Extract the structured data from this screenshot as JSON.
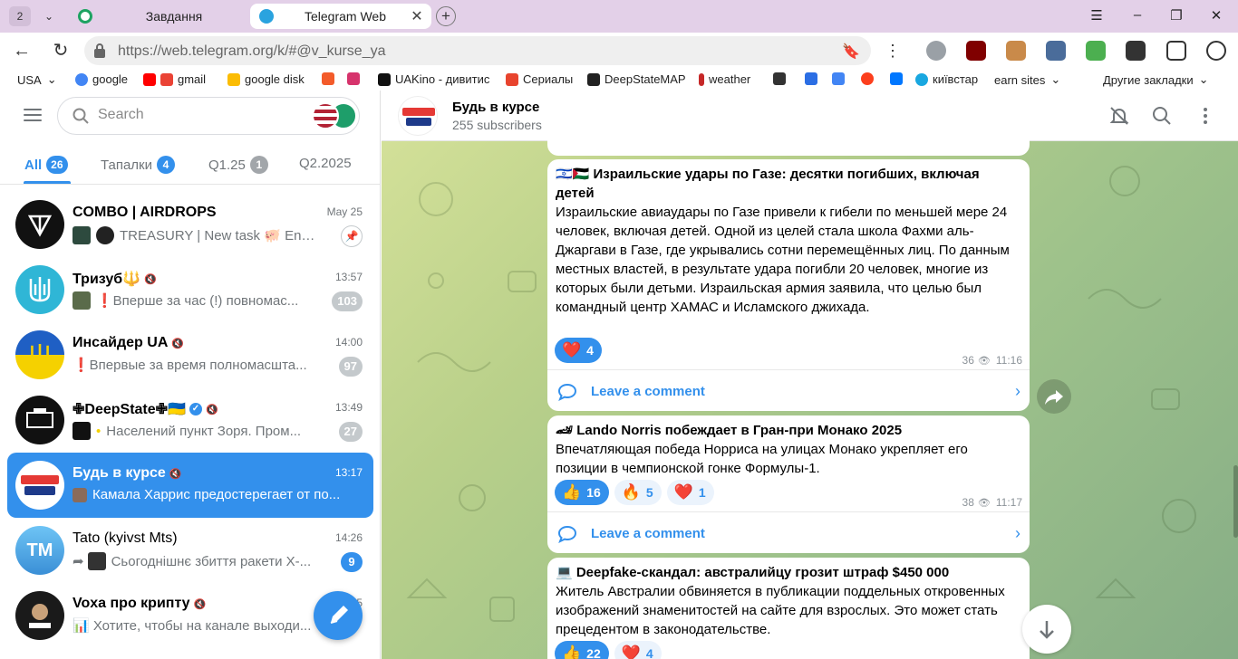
{
  "browser": {
    "tab_count": "2",
    "tabs": [
      {
        "title": "Завдання"
      },
      {
        "title": "Telegram Web"
      }
    ],
    "url": "https://web.telegram.org/k/#@v_kurse_ya",
    "bookmarks": [
      {
        "label": "USA"
      },
      {
        "label": "google"
      },
      {
        "label": "gmail"
      },
      {
        "label": "google disk"
      },
      {
        "label": "UAKino - дивитис"
      },
      {
        "label": "Сериалы"
      },
      {
        "label": "DeepStateMAP"
      },
      {
        "label": "weather"
      },
      {
        "label": "київстар"
      },
      {
        "label": "earn sites"
      },
      {
        "label": "Другие закладки"
      }
    ]
  },
  "sidebar": {
    "search_placeholder": "Search",
    "folders": [
      {
        "label": "All",
        "badge": "26"
      },
      {
        "label": "Тапалки",
        "badge": "4"
      },
      {
        "label": "Q1.25",
        "badge": "1"
      },
      {
        "label": "Q2.2025",
        "badge": ""
      }
    ],
    "chats": [
      {
        "name": "COMBO | AIRDROPS",
        "time": "May 25",
        "preview": "TREASURY | New task 🐖 Enter t...",
        "unread": ""
      },
      {
        "name": "Тризуб🔱",
        "time": "13:57",
        "preview": "❗️Вперше за час (!) повномас...",
        "unread": "103"
      },
      {
        "name": "Инсайдер UA",
        "time": "14:00",
        "preview": "❗️Впервые за время полномасшта...",
        "unread": "97"
      },
      {
        "name": "✙DeepState✙🇺🇦",
        "time": "13:49",
        "preview": "Населений пункт Зоря. Пром...",
        "unread": "27"
      },
      {
        "name": "Будь в курсе",
        "time": "13:17",
        "preview": "Камала Харрис предостерегает от по...",
        "unread": ""
      },
      {
        "name": "Tato (kyivst Mts)",
        "time": "14:26",
        "preview": "Сьогоднішнє збиття ракети Х-...",
        "unread": "9",
        "initials": "TM"
      },
      {
        "name": "Voxa про крипту",
        "time": "5",
        "preview": "📊 Хотите, чтобы на канале выходи...",
        "unread": ""
      }
    ]
  },
  "chat": {
    "title": "Будь в курсе",
    "subtitle": "255 subscribers",
    "messages": [
      {
        "headline": "🇮🇱🇵🇸 Израильские удары по Газе: десятки погибших, включая детей",
        "text": "Израильские авиаудары по Газе привели к гибели по меньшей мере 24 человек, включая детей. Одной из целей стала школа Фахми аль-Джаргави в Газе, где укрывались сотни перемещённых лиц. По данным местных властей, в результате удара погибли 20 человек, многие из которых были детьми. Израильская армия заявила, что целью был командный центр ХАМАС и Исламского джихада.",
        "reactions": [
          {
            "emoji": "❤️",
            "count": "4"
          }
        ],
        "views": "36",
        "time": "11:16",
        "comment_label": "Leave a comment"
      },
      {
        "headline": "🏎 Lando Norris побеждает в Гран-при Монако 2025",
        "text": "Впечатляющая победа Норриса на улицах Монако укрепляет его позиции в чемпионской гонке Формулы-1.",
        "reactions": [
          {
            "emoji": "👍",
            "count": "16"
          },
          {
            "emoji": "🔥",
            "count": "5"
          },
          {
            "emoji": "❤️",
            "count": "1"
          }
        ],
        "views": "38",
        "time": "11:17",
        "comment_label": "Leave a comment"
      },
      {
        "headline": "💻 Deepfake-скандал: австралийцу грозит штраф $450 000",
        "text": "Житель Австралии обвиняется в публикации поддельных откровенных изображений знаменитостей на сайте для взрослых. Это может стать прецедентом в законодательстве.",
        "reactions": [
          {
            "emoji": "👍",
            "count": "22"
          },
          {
            "emoji": "❤️",
            "count": "4"
          }
        ]
      }
    ]
  },
  "colors": {
    "accent": "#3390ec",
    "tabbar": "#e3d0e8"
  }
}
